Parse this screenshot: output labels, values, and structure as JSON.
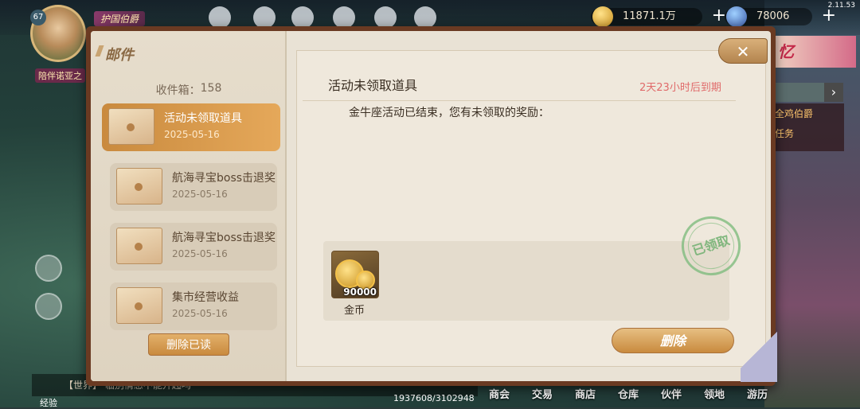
{
  "hud": {
    "version": "2.11.53",
    "level": "67",
    "player_name": "陪伴诺亚之",
    "title_tag": "护国伯爵",
    "gold": "11871.1万",
    "diamond": "78006",
    "chat_prefix": "【世界】",
    "chat_text": "临别情感不能开起吗",
    "exp": "1937608/3102948",
    "exp_label": "经验",
    "right_banner": "忆",
    "right_list": [
      "全鸡伯爵",
      "任务"
    ],
    "bottom_nav": [
      "商会",
      "交易",
      "商店",
      "仓库",
      "伙伴",
      "领地",
      "游历"
    ]
  },
  "mail": {
    "title": "邮件",
    "inbox_label": "收件箱：",
    "inbox_count": "158",
    "items": [
      {
        "subject": "活动未领取道具",
        "date": "2025-05-16",
        "active": true
      },
      {
        "subject": "航海寻宝boss击退奖",
        "date": "2025-05-16",
        "active": false
      },
      {
        "subject": "航海寻宝boss击退奖",
        "date": "2025-05-16",
        "active": false
      },
      {
        "subject": "集市经营收益",
        "date": "2025-05-16",
        "active": false
      }
    ],
    "delete_read_label": "删除已读",
    "close_icon": "close-icon",
    "detail": {
      "title": "活动未领取道具",
      "expire": "2天23小时后到期",
      "body": "金牛座活动已结束，您有未领取的奖励：",
      "rewards": [
        {
          "name": "金币",
          "qty": "90000",
          "icon": "gold-coin-icon"
        }
      ],
      "claimed_stamp": "已领取",
      "delete_label": "删除"
    }
  }
}
